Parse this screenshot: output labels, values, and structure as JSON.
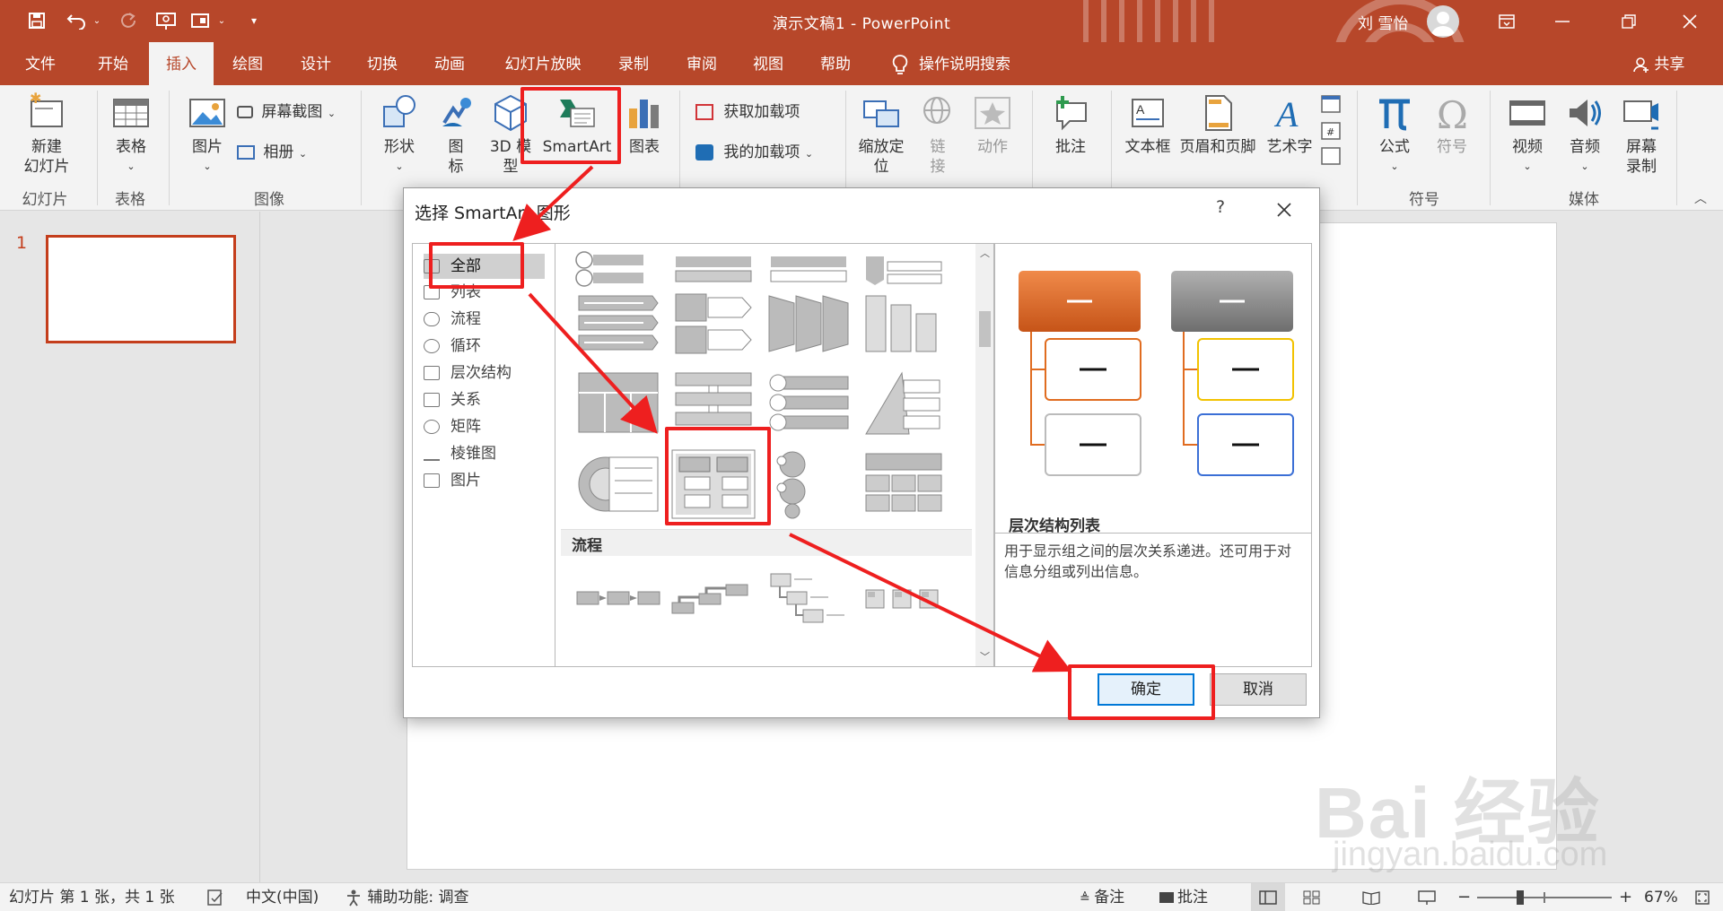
{
  "titlebar": {
    "title": "演示文稿1  -  PowerPoint",
    "user": "刘 雪怡",
    "quick_access": [
      "save-icon",
      "undo-icon",
      "redo-icon",
      "present-icon",
      "layout-icon",
      "customize-icon"
    ],
    "window_buttons": [
      "ribbon-display-icon",
      "minimize-icon",
      "restore-icon",
      "close-icon"
    ]
  },
  "tabs": [
    "文件",
    "开始",
    "插入",
    "绘图",
    "设计",
    "切换",
    "动画",
    "幻灯片放映",
    "录制",
    "审阅",
    "视图",
    "帮助"
  ],
  "active_tab": "插入",
  "tell_me": "操作说明搜索",
  "share": "共享",
  "ribbon": {
    "new_slide": [
      "新建",
      "幻灯片"
    ],
    "table": "表格",
    "picture": "图片",
    "screenshot": "屏幕截图",
    "album": "相册",
    "shapes": "形状",
    "icons": [
      "图",
      "标"
    ],
    "model3d": [
      "3D 模",
      "型"
    ],
    "smartart": "SmartArt",
    "chart": "图表",
    "get_addins": "获取加载项",
    "my_addins": "我的加载项",
    "zoom": [
      "缩放定",
      "位"
    ],
    "link": [
      "链",
      "接"
    ],
    "action": "动作",
    "comment": "批注",
    "textbox": "文本框",
    "header_footer": "页眉和页脚",
    "wordart": "艺术字",
    "equation": "公式",
    "symbol": "符号",
    "video": "视频",
    "audio": "音频",
    "screen_rec": [
      "屏幕",
      "录制"
    ],
    "groups": {
      "slides": "幻灯片",
      "tables": "表格",
      "images": "图像",
      "symbols": "符号",
      "media": "媒体"
    }
  },
  "thumbnail": {
    "number": "1"
  },
  "dialog": {
    "title": "选择 SmartArt 图形",
    "help": "?",
    "categories": [
      "全部",
      "列表",
      "流程",
      "循环",
      "层次结构",
      "关系",
      "矩阵",
      "棱锥图",
      "图片"
    ],
    "selected_category": "全部",
    "section_label": "流程",
    "preview_name": "层次结构列表",
    "preview_desc": "用于显示组之间的层次关系递进。还可用于对信息分组或列出信息。",
    "ok": "确定",
    "cancel": "取消"
  },
  "status": {
    "slide_info": "幻灯片 第 1 张，共 1 张",
    "language": "中文(中国)",
    "accessibility": "辅助功能: 调查",
    "notes": "备注",
    "comments": "批注",
    "zoom": "67%",
    "zoom_level_fraction": 0.67
  },
  "watermark": {
    "line1": "Bai 经验",
    "line2": "jingyan.baidu.com"
  },
  "colors": {
    "accent": "#b7472a",
    "highlight": "#ee1f1f",
    "orange_box": "#e06c20"
  }
}
